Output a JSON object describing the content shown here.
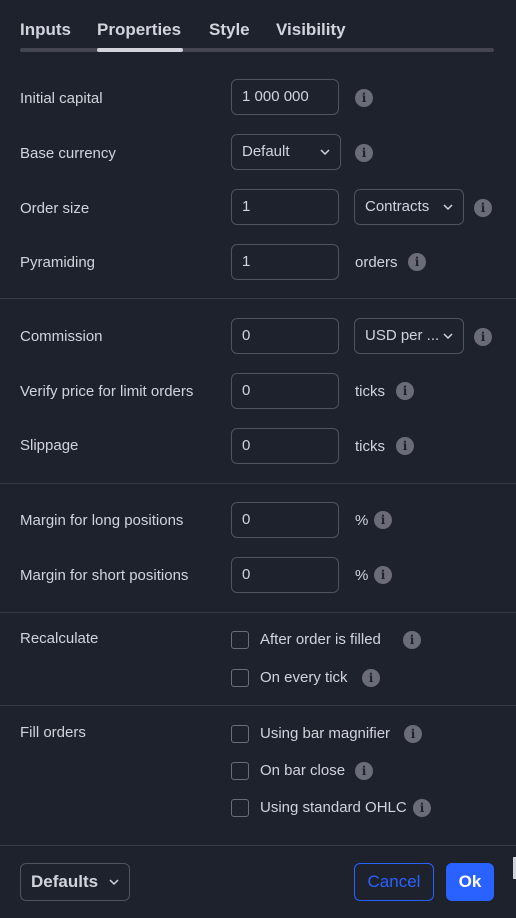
{
  "tabs": [
    {
      "label": "Inputs"
    },
    {
      "label": "Properties",
      "active": true
    },
    {
      "label": "Style"
    },
    {
      "label": "Visibility"
    }
  ],
  "initial_capital": {
    "label": "Initial capital",
    "value": "1 000 000"
  },
  "base_currency": {
    "label": "Base currency",
    "value": "Default"
  },
  "order_size": {
    "label": "Order size",
    "value": "1",
    "unit_select": "Contracts"
  },
  "pyramiding": {
    "label": "Pyramiding",
    "value": "1",
    "unit": "orders"
  },
  "commission": {
    "label": "Commission",
    "value": "0",
    "unit_select": "USD per ..."
  },
  "verify_price": {
    "label": "Verify price for limit orders",
    "value": "0",
    "unit": "ticks"
  },
  "slippage": {
    "label": "Slippage",
    "value": "0",
    "unit": "ticks"
  },
  "margin_long": {
    "label": "Margin for long positions",
    "value": "0",
    "unit": "%"
  },
  "margin_short": {
    "label": "Margin for short positions",
    "value": "0",
    "unit": "%"
  },
  "recalculate": {
    "label": "Recalculate",
    "options": [
      {
        "label": "After order is filled",
        "checked": false
      },
      {
        "label": "On every tick",
        "checked": false
      }
    ]
  },
  "fill_orders": {
    "label": "Fill orders",
    "options": [
      {
        "label": "Using bar magnifier",
        "checked": false
      },
      {
        "label": "On bar close",
        "checked": false
      },
      {
        "label": "Using standard OHLC",
        "checked": false
      }
    ]
  },
  "footer": {
    "defaults_label": "Defaults",
    "cancel_label": "Cancel",
    "ok_label": "Ok"
  },
  "icons": {
    "info": "info-icon",
    "chevron": "chevron-down-icon"
  },
  "colors": {
    "background": "#1e222d",
    "accent": "#2962ff",
    "text": "#d1d4dc",
    "border": "#50535e"
  }
}
